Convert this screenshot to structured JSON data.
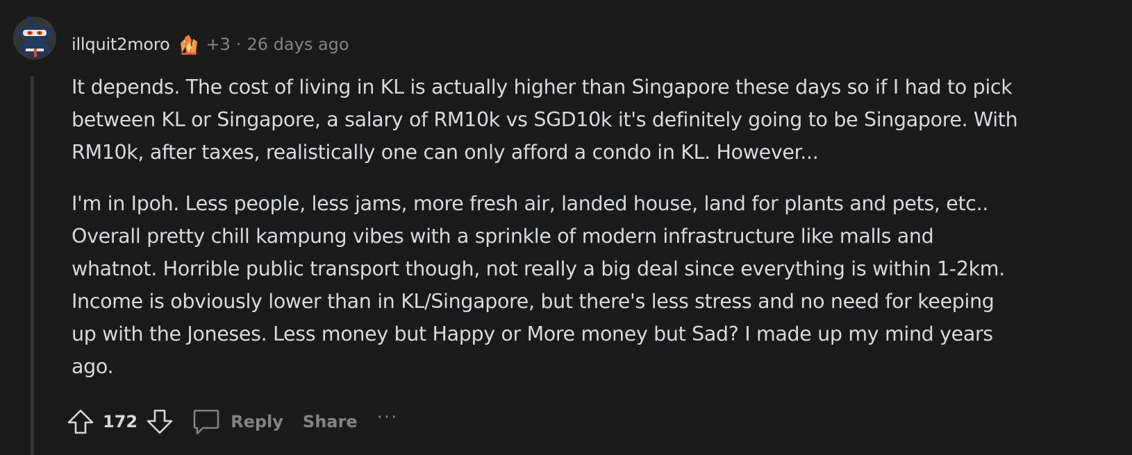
{
  "comment": {
    "author": "illquit2moro",
    "author_avatar_icon": "snoo-ninja-avatar-icon",
    "flair_icon": "crystal-flair-icon",
    "karma_badge": "+3",
    "separator": "·",
    "timestamp": "26 days ago",
    "paragraphs": [
      "It depends. The cost of living in KL is actually higher than Singapore these days so if I had to pick\nbetween KL or Singapore, a salary of RM10k vs SGD10k it's definitely going to be Singapore. With\nRM10k, after taxes, realistically one can only afford a condo in KL. However...",
      "I'm in Ipoh. Less people, less jams, more fresh air, landed house, land for plants and pets, etc..\nOverall pretty chill kampung vibes with a sprinkle of modern infrastructure like malls and\nwhatnot. Horrible public transport though, not really a big deal since everything is within 1-2km.\nIncome is obviously lower than in KL/Singapore, but there's less stress and no need for keeping\nup with the Joneses. Less money but Happy or More money but Sad? I made up my mind years\nago."
    ]
  },
  "actions": {
    "upvote_icon": "upvote-arrow-icon",
    "downvote_icon": "downvote-arrow-icon",
    "vote_count": "172",
    "reply_icon": "comment-bubble-icon",
    "reply_label": "Reply",
    "share_label": "Share",
    "more_label": "···"
  },
  "colors": {
    "background": "#1a1a1b",
    "text_primary": "#d7dadc",
    "text_secondary": "#818384",
    "thread_line": "#343536"
  }
}
